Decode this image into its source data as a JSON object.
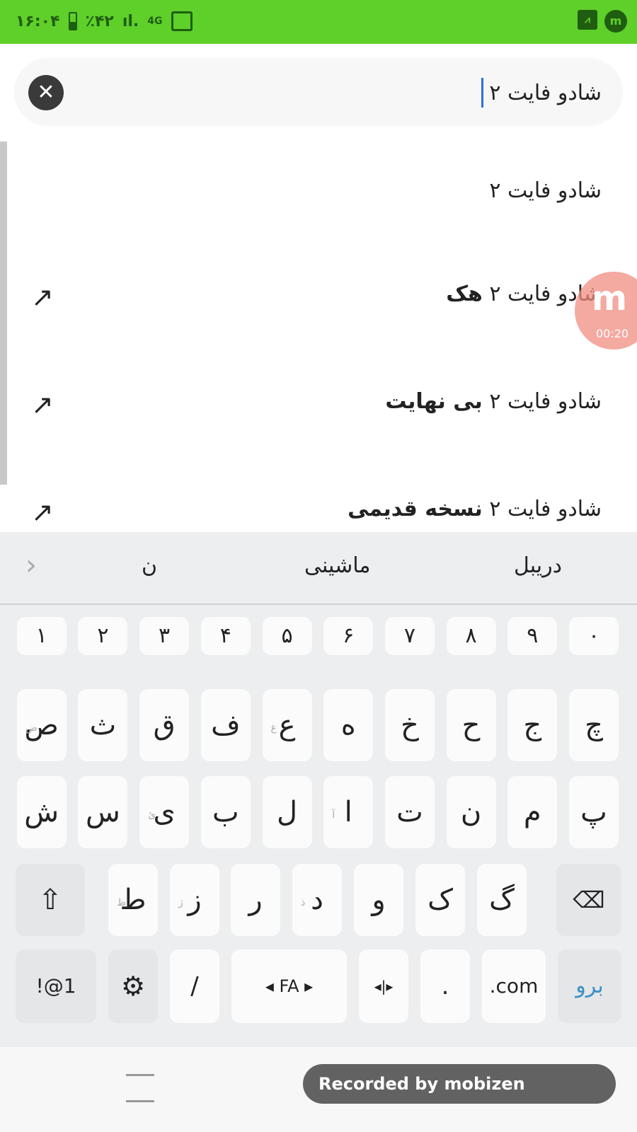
{
  "status_bar": {
    "time": "۱۶:۰۴",
    "battery": "٪۴۲",
    "network": "4G",
    "background": "#5fcf2a"
  },
  "search": {
    "value": "شادو فایت ۲",
    "clear_icon": "close-circle-icon"
  },
  "suggestions": [
    {
      "prefix": "شادو فایت ۲",
      "suffix": "",
      "has_arrow": false
    },
    {
      "prefix": "شادو فایت ۲",
      "suffix": "هک",
      "has_arrow": true
    },
    {
      "prefix": "شادو فایت ۲",
      "suffix": "بی نهایت",
      "has_arrow": true
    },
    {
      "prefix": "شادو فایت ۲",
      "suffix": "نسخه قدیمی",
      "has_arrow": true
    }
  ],
  "recorder_bubble": {
    "logo": "m",
    "timer": "00:20"
  },
  "keyboard": {
    "suggestions": [
      "دریبل",
      "ماشینی",
      "ن"
    ],
    "row1": [
      "۰",
      "۹",
      "۸",
      "۷",
      "۶",
      "۵",
      "۴",
      "۳",
      "۲",
      "۱"
    ],
    "row2": [
      "چ",
      "ج",
      "ح",
      "خ",
      "ه",
      "ع",
      "ف",
      "ق",
      "ث",
      "ص"
    ],
    "row2_hints": [
      "",
      "",
      "",
      "",
      "",
      "غ",
      "",
      "",
      "",
      "ض"
    ],
    "row3": [
      "پ",
      "م",
      "ن",
      "ت",
      "ا",
      "ل",
      "ب",
      "ی",
      "س",
      "ش"
    ],
    "row3_hints": [
      "",
      "",
      "",
      "",
      "آ",
      "",
      "",
      "ئ",
      "",
      ""
    ],
    "row4": [
      "گ",
      "ک",
      "و",
      "د",
      "ر",
      "ز",
      "ط"
    ],
    "row4_hints": [
      "",
      "",
      "",
      "ذ",
      "",
      "ژ",
      "ظ"
    ],
    "row5": {
      "symbols": "!@1",
      "language": "◂ FA ▸",
      "slash": "/",
      "cursor": "◂|▸",
      "period": ".",
      "dotcom": ".com",
      "go": "برو"
    }
  },
  "watermark": "Recorded by mobizen"
}
